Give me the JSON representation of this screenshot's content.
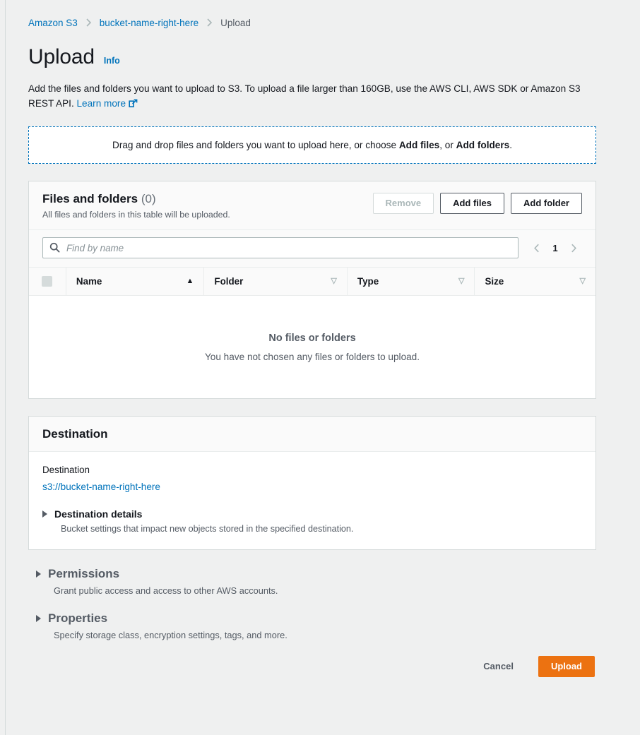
{
  "breadcrumb": {
    "items": [
      {
        "label": "Amazon S3",
        "type": "link"
      },
      {
        "label": "bucket-name-right-here",
        "type": "link"
      },
      {
        "label": "Upload",
        "type": "current"
      }
    ]
  },
  "header": {
    "title": "Upload",
    "info_label": "Info",
    "description_part1": "Add the files and folders you want to upload to S3. To upload a file larger than 160GB, use the AWS CLI, AWS SDK or Amazon S3 REST API. ",
    "learn_more_label": "Learn more"
  },
  "dropzone": {
    "text_before": "Drag and drop files and folders you want to upload here, or choose ",
    "bold_1": "Add files",
    "text_middle": ", or ",
    "bold_2": "Add folders",
    "text_after": "."
  },
  "files_card": {
    "title": "Files and folders",
    "count": "(0)",
    "subtitle": "All files and folders in this table will be uploaded.",
    "buttons": {
      "remove": "Remove",
      "add_files": "Add files",
      "add_folder": "Add folder"
    },
    "search": {
      "placeholder": "Find by name",
      "value": "",
      "icon": "search-icon"
    },
    "pagination": {
      "prev_icon": "chevron-left-icon",
      "page": "1",
      "next_icon": "chevron-right-icon"
    },
    "table": {
      "columns": [
        {
          "label": "Name",
          "sort": "asc"
        },
        {
          "label": "Folder",
          "sort": "none"
        },
        {
          "label": "Type",
          "sort": "none"
        },
        {
          "label": "Size",
          "sort": "none"
        }
      ],
      "rows": [],
      "empty_title": "No files or folders",
      "empty_subtitle": "You have not chosen any files or folders to upload."
    }
  },
  "destination_card": {
    "title": "Destination",
    "field_label": "Destination",
    "value": "s3://bucket-name-right-here",
    "details": {
      "title": "Destination details",
      "description": "Bucket settings that impact new objects stored in the specified destination."
    }
  },
  "sections": [
    {
      "title": "Permissions",
      "description": "Grant public access and access to other AWS accounts."
    },
    {
      "title": "Properties",
      "description": "Specify storage class, encryption settings, tags, and more."
    }
  ],
  "footer": {
    "cancel": "Cancel",
    "upload": "Upload"
  },
  "colors": {
    "link": "#0073bb",
    "primary": "#ec7211",
    "page_background": "#eff0f0",
    "card_header": "#fafafa",
    "border": "#d5dbdb",
    "muted_text": "#545b64"
  }
}
